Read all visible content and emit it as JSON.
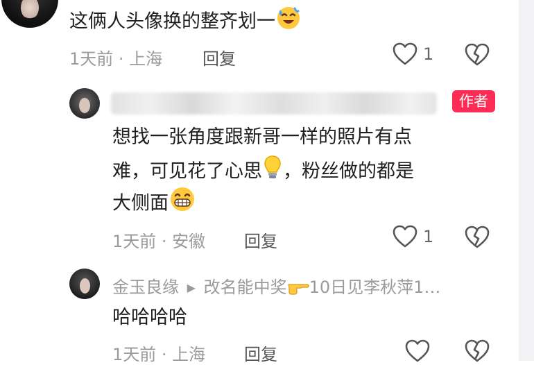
{
  "comments": [
    {
      "text": "这俩人头像换的整齐划一",
      "emoji": "😅",
      "meta": "1天前 · 上海",
      "reply": "回复",
      "likes": "1"
    },
    {
      "author_badge": "作者",
      "line1": "想找一张角度跟新哥一样的照片有点",
      "line2a": "难，可见花了心思",
      "line2b": "，粉丝做的都是",
      "line3": "大侧面",
      "meta": "1天前 · 安徽",
      "reply": "回复",
      "likes": "1"
    },
    {
      "username": "金玉良缘",
      "reply_arrow": "▶",
      "reply_to": "改名能中奖",
      "reply_to_suffix": "10日见李秋萍1…",
      "text": "哈哈哈哈",
      "meta": "1天前 · 上海",
      "reply": "回复"
    }
  ],
  "icons": {
    "like": "heart-outline-icon",
    "dislike": "broken-heart-icon",
    "bulb": "lightbulb-icon",
    "grin": "grinning-face-icon",
    "point": "pointing-hand-icon",
    "sweat": "sweat-smile-icon"
  }
}
